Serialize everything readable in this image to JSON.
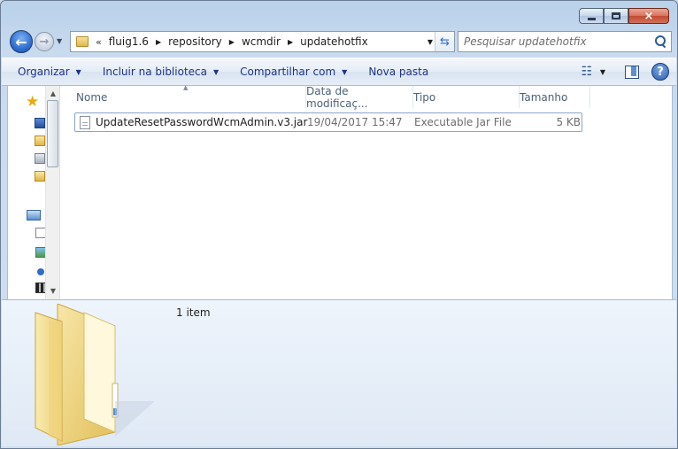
{
  "window": {
    "minimize_label": "minimize",
    "maximize_label": "maximize",
    "close_label": "×"
  },
  "address": {
    "overflow": "«",
    "crumbs": [
      "fluig1.6",
      "repository",
      "wcmdir",
      "updatehotfix"
    ]
  },
  "search": {
    "placeholder": "Pesquisar updatehotfix"
  },
  "toolbar": {
    "organize": "Organizar",
    "include_library": "Incluir na biblioteca",
    "share": "Compartilhar com",
    "new_folder": "Nova pasta",
    "help": "?"
  },
  "columns": {
    "name": "Nome",
    "date": "Data de modificaç...",
    "type": "Tipo",
    "size": "Tamanho"
  },
  "files": [
    {
      "name": "UpdateResetPasswordWcmAdmin.v3.jar",
      "date": "19/04/2017 15:47",
      "type": "Executable Jar File",
      "size": "5 KB"
    }
  ],
  "details": {
    "item_count": "1 item"
  },
  "colors": {
    "toolbar_text": "#1e3287",
    "selection_border": "#8aa6c8",
    "folder_yellow": "#f0d27a"
  }
}
